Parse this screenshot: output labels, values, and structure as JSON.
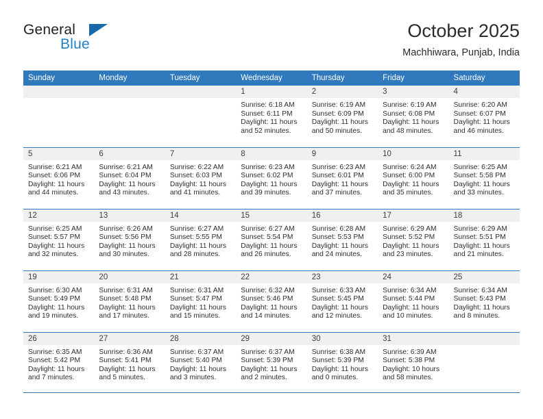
{
  "brand": {
    "name_part1": "General",
    "name_part2": "Blue",
    "triangle_color": "#1769aa",
    "blue_color": "#1f7fc4"
  },
  "header": {
    "month_title": "October 2025",
    "location": "Machhiwara, Punjab, India"
  },
  "theme": {
    "header_blue": "#3079bd",
    "daynum_band": "#f0f0f0"
  },
  "weekdays": [
    "Sunday",
    "Monday",
    "Tuesday",
    "Wednesday",
    "Thursday",
    "Friday",
    "Saturday"
  ],
  "weeks": [
    [
      {
        "day": "",
        "empty": true,
        "sunrise": "",
        "sunset": "",
        "daylight1": "",
        "daylight2": ""
      },
      {
        "day": "",
        "empty": true,
        "sunrise": "",
        "sunset": "",
        "daylight1": "",
        "daylight2": ""
      },
      {
        "day": "",
        "empty": true,
        "sunrise": "",
        "sunset": "",
        "daylight1": "",
        "daylight2": ""
      },
      {
        "day": "1",
        "empty": false,
        "sunrise": "Sunrise: 6:18 AM",
        "sunset": "Sunset: 6:11 PM",
        "daylight1": "Daylight: 11 hours",
        "daylight2": "and 52 minutes."
      },
      {
        "day": "2",
        "empty": false,
        "sunrise": "Sunrise: 6:19 AM",
        "sunset": "Sunset: 6:09 PM",
        "daylight1": "Daylight: 11 hours",
        "daylight2": "and 50 minutes."
      },
      {
        "day": "3",
        "empty": false,
        "sunrise": "Sunrise: 6:19 AM",
        "sunset": "Sunset: 6:08 PM",
        "daylight1": "Daylight: 11 hours",
        "daylight2": "and 48 minutes."
      },
      {
        "day": "4",
        "empty": false,
        "sunrise": "Sunrise: 6:20 AM",
        "sunset": "Sunset: 6:07 PM",
        "daylight1": "Daylight: 11 hours",
        "daylight2": "and 46 minutes."
      }
    ],
    [
      {
        "day": "5",
        "empty": false,
        "sunrise": "Sunrise: 6:21 AM",
        "sunset": "Sunset: 6:06 PM",
        "daylight1": "Daylight: 11 hours",
        "daylight2": "and 44 minutes."
      },
      {
        "day": "6",
        "empty": false,
        "sunrise": "Sunrise: 6:21 AM",
        "sunset": "Sunset: 6:04 PM",
        "daylight1": "Daylight: 11 hours",
        "daylight2": "and 43 minutes."
      },
      {
        "day": "7",
        "empty": false,
        "sunrise": "Sunrise: 6:22 AM",
        "sunset": "Sunset: 6:03 PM",
        "daylight1": "Daylight: 11 hours",
        "daylight2": "and 41 minutes."
      },
      {
        "day": "8",
        "empty": false,
        "sunrise": "Sunrise: 6:23 AM",
        "sunset": "Sunset: 6:02 PM",
        "daylight1": "Daylight: 11 hours",
        "daylight2": "and 39 minutes."
      },
      {
        "day": "9",
        "empty": false,
        "sunrise": "Sunrise: 6:23 AM",
        "sunset": "Sunset: 6:01 PM",
        "daylight1": "Daylight: 11 hours",
        "daylight2": "and 37 minutes."
      },
      {
        "day": "10",
        "empty": false,
        "sunrise": "Sunrise: 6:24 AM",
        "sunset": "Sunset: 6:00 PM",
        "daylight1": "Daylight: 11 hours",
        "daylight2": "and 35 minutes."
      },
      {
        "day": "11",
        "empty": false,
        "sunrise": "Sunrise: 6:25 AM",
        "sunset": "Sunset: 5:58 PM",
        "daylight1": "Daylight: 11 hours",
        "daylight2": "and 33 minutes."
      }
    ],
    [
      {
        "day": "12",
        "empty": false,
        "sunrise": "Sunrise: 6:25 AM",
        "sunset": "Sunset: 5:57 PM",
        "daylight1": "Daylight: 11 hours",
        "daylight2": "and 32 minutes."
      },
      {
        "day": "13",
        "empty": false,
        "sunrise": "Sunrise: 6:26 AM",
        "sunset": "Sunset: 5:56 PM",
        "daylight1": "Daylight: 11 hours",
        "daylight2": "and 30 minutes."
      },
      {
        "day": "14",
        "empty": false,
        "sunrise": "Sunrise: 6:27 AM",
        "sunset": "Sunset: 5:55 PM",
        "daylight1": "Daylight: 11 hours",
        "daylight2": "and 28 minutes."
      },
      {
        "day": "15",
        "empty": false,
        "sunrise": "Sunrise: 6:27 AM",
        "sunset": "Sunset: 5:54 PM",
        "daylight1": "Daylight: 11 hours",
        "daylight2": "and 26 minutes."
      },
      {
        "day": "16",
        "empty": false,
        "sunrise": "Sunrise: 6:28 AM",
        "sunset": "Sunset: 5:53 PM",
        "daylight1": "Daylight: 11 hours",
        "daylight2": "and 24 minutes."
      },
      {
        "day": "17",
        "empty": false,
        "sunrise": "Sunrise: 6:29 AM",
        "sunset": "Sunset: 5:52 PM",
        "daylight1": "Daylight: 11 hours",
        "daylight2": "and 23 minutes."
      },
      {
        "day": "18",
        "empty": false,
        "sunrise": "Sunrise: 6:29 AM",
        "sunset": "Sunset: 5:51 PM",
        "daylight1": "Daylight: 11 hours",
        "daylight2": "and 21 minutes."
      }
    ],
    [
      {
        "day": "19",
        "empty": false,
        "sunrise": "Sunrise: 6:30 AM",
        "sunset": "Sunset: 5:49 PM",
        "daylight1": "Daylight: 11 hours",
        "daylight2": "and 19 minutes."
      },
      {
        "day": "20",
        "empty": false,
        "sunrise": "Sunrise: 6:31 AM",
        "sunset": "Sunset: 5:48 PM",
        "daylight1": "Daylight: 11 hours",
        "daylight2": "and 17 minutes."
      },
      {
        "day": "21",
        "empty": false,
        "sunrise": "Sunrise: 6:31 AM",
        "sunset": "Sunset: 5:47 PM",
        "daylight1": "Daylight: 11 hours",
        "daylight2": "and 15 minutes."
      },
      {
        "day": "22",
        "empty": false,
        "sunrise": "Sunrise: 6:32 AM",
        "sunset": "Sunset: 5:46 PM",
        "daylight1": "Daylight: 11 hours",
        "daylight2": "and 14 minutes."
      },
      {
        "day": "23",
        "empty": false,
        "sunrise": "Sunrise: 6:33 AM",
        "sunset": "Sunset: 5:45 PM",
        "daylight1": "Daylight: 11 hours",
        "daylight2": "and 12 minutes."
      },
      {
        "day": "24",
        "empty": false,
        "sunrise": "Sunrise: 6:34 AM",
        "sunset": "Sunset: 5:44 PM",
        "daylight1": "Daylight: 11 hours",
        "daylight2": "and 10 minutes."
      },
      {
        "day": "25",
        "empty": false,
        "sunrise": "Sunrise: 6:34 AM",
        "sunset": "Sunset: 5:43 PM",
        "daylight1": "Daylight: 11 hours",
        "daylight2": "and 8 minutes."
      }
    ],
    [
      {
        "day": "26",
        "empty": false,
        "sunrise": "Sunrise: 6:35 AM",
        "sunset": "Sunset: 5:42 PM",
        "daylight1": "Daylight: 11 hours",
        "daylight2": "and 7 minutes."
      },
      {
        "day": "27",
        "empty": false,
        "sunrise": "Sunrise: 6:36 AM",
        "sunset": "Sunset: 5:41 PM",
        "daylight1": "Daylight: 11 hours",
        "daylight2": "and 5 minutes."
      },
      {
        "day": "28",
        "empty": false,
        "sunrise": "Sunrise: 6:37 AM",
        "sunset": "Sunset: 5:40 PM",
        "daylight1": "Daylight: 11 hours",
        "daylight2": "and 3 minutes."
      },
      {
        "day": "29",
        "empty": false,
        "sunrise": "Sunrise: 6:37 AM",
        "sunset": "Sunset: 5:39 PM",
        "daylight1": "Daylight: 11 hours",
        "daylight2": "and 2 minutes."
      },
      {
        "day": "30",
        "empty": false,
        "sunrise": "Sunrise: 6:38 AM",
        "sunset": "Sunset: 5:39 PM",
        "daylight1": "Daylight: 11 hours",
        "daylight2": "and 0 minutes."
      },
      {
        "day": "31",
        "empty": false,
        "sunrise": "Sunrise: 6:39 AM",
        "sunset": "Sunset: 5:38 PM",
        "daylight1": "Daylight: 10 hours",
        "daylight2": "and 58 minutes."
      },
      {
        "day": "",
        "empty": true,
        "sunrise": "",
        "sunset": "",
        "daylight1": "",
        "daylight2": ""
      }
    ]
  ]
}
